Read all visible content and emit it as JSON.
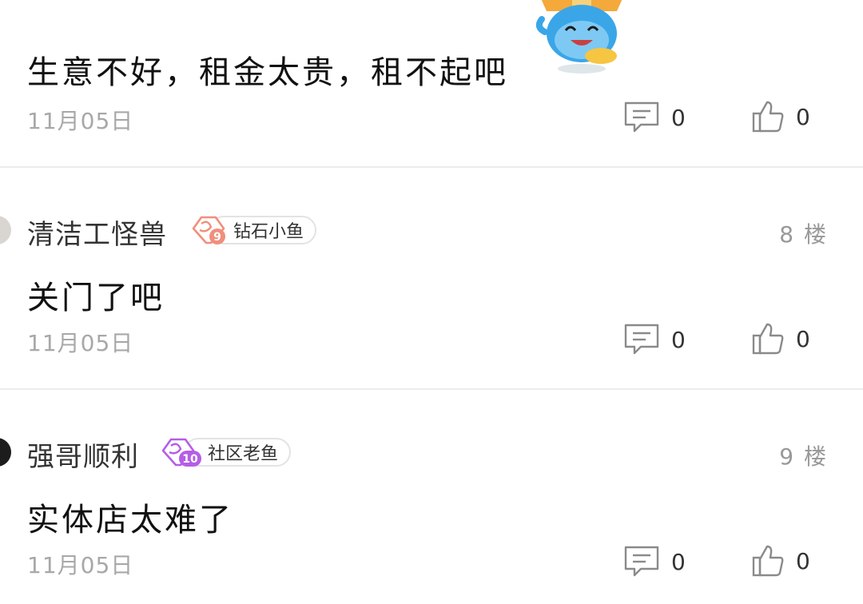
{
  "comments": [
    {
      "text": "生意不好，租金太贵，租不起吧",
      "date": "11月05日",
      "reply_count": "0",
      "like_count": "0"
    },
    {
      "username": "清洁工怪兽",
      "badge_level": "9",
      "badge_label": "钻石小鱼",
      "badge_color": "#f08f7c",
      "floor": "8 楼",
      "text": "关门了吧",
      "date": "11月05日",
      "reply_count": "0",
      "like_count": "0"
    },
    {
      "username": "强哥顺利",
      "badge_level": "10",
      "badge_label": "社区老鱼",
      "badge_color": "#b65de6",
      "floor": "9 楼",
      "text": "实体店太难了",
      "date": "11月05日",
      "reply_count": "0",
      "like_count": "0"
    }
  ],
  "icons": {
    "reply": "comment-icon",
    "like": "thumbs-up-icon",
    "badge": "fish-badge-icon",
    "sticker": "fish-mascot-sticker"
  }
}
